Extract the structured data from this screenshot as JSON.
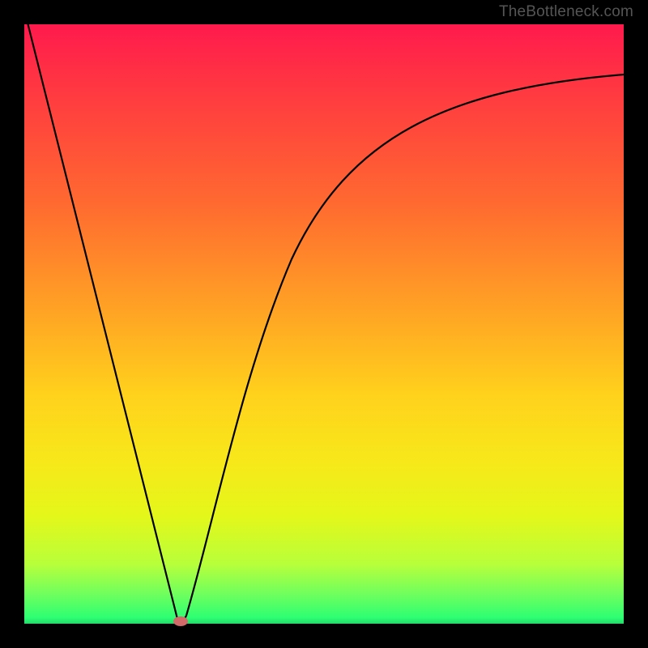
{
  "watermark": "TheBottleneck.com",
  "chart_data": {
    "type": "line",
    "title": "",
    "x": [
      0.0,
      0.02,
      0.04,
      0.06,
      0.08,
      0.1,
      0.12,
      0.14,
      0.16,
      0.18,
      0.2,
      0.22,
      0.24,
      0.26,
      0.28,
      0.3,
      0.32,
      0.36,
      0.4,
      0.45,
      0.5,
      0.55,
      0.6,
      0.65,
      0.7,
      0.75,
      0.8,
      0.85,
      0.9,
      0.95,
      1.0
    ],
    "y": [
      1.0,
      0.92,
      0.84,
      0.76,
      0.68,
      0.6,
      0.52,
      0.44,
      0.36,
      0.28,
      0.2,
      0.12,
      0.04,
      0.0,
      0.1,
      0.24,
      0.36,
      0.52,
      0.63,
      0.71,
      0.77,
      0.81,
      0.84,
      0.86,
      0.88,
      0.89,
      0.9,
      0.91,
      0.91,
      0.92,
      0.92
    ],
    "xlabel": "",
    "ylabel": "",
    "xlim": [
      0,
      1
    ],
    "ylim": [
      0,
      1
    ],
    "marker": {
      "x": 0.26,
      "y": 0.0
    },
    "background_gradient": {
      "direction": "vertical",
      "stops": [
        {
          "pos": 0.0,
          "color": "#ff1a4d"
        },
        {
          "pos": 0.5,
          "color": "#ffb020"
        },
        {
          "pos": 0.8,
          "color": "#f0f01a"
        },
        {
          "pos": 1.0,
          "color": "#23d96b"
        }
      ]
    },
    "note": "Axes are unlabeled in the source image; x and y normalized 0–1. Curve is a sharp V reaching 0 near x≈0.26, rising asymptotically toward ~0.92 on the right. Values are visual estimates."
  }
}
